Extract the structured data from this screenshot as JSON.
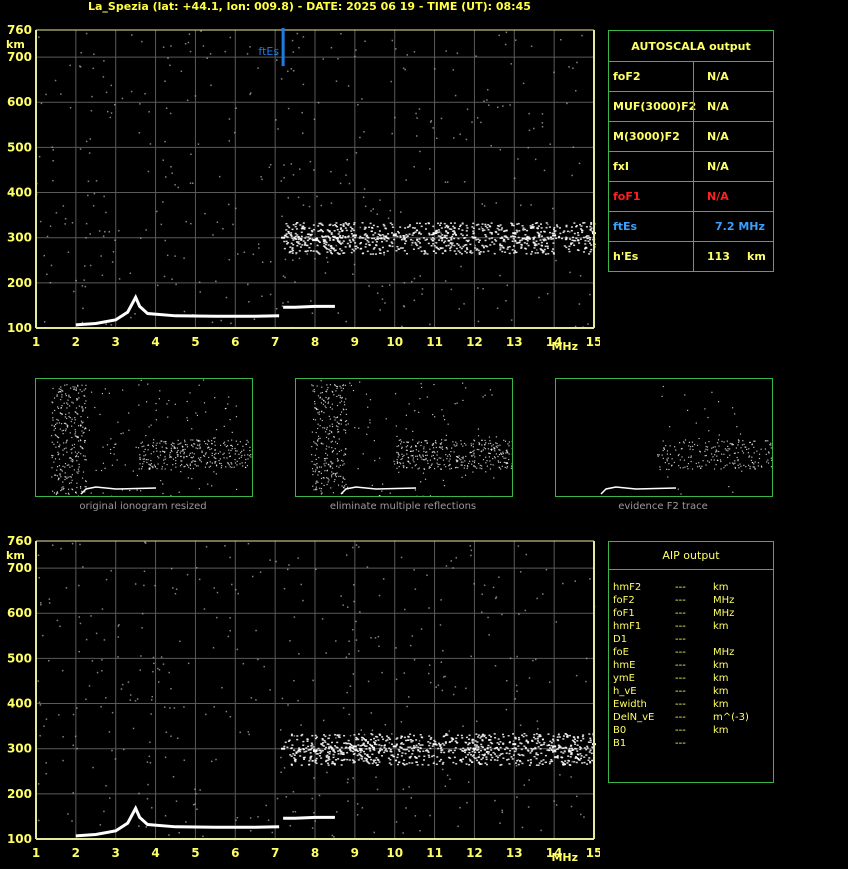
{
  "header": {
    "title": "La_Spezia (lat: +44.1, lon: 009.8) - DATE: 2025 06 19 - TIME (UT): 08:45"
  },
  "colors": {
    "axis": "#e8e89a",
    "grid": "#5a5a5a",
    "trace": "#ffffff",
    "fte_marker": "#1e7de0",
    "panel_border": "#39b54a",
    "label_yellow": "#ffff66",
    "label_red": "#ff2020",
    "label_blue": "#3aa0ff"
  },
  "chart_data": [
    {
      "type": "scatter",
      "title": "",
      "xlabel": "MHz",
      "ylabel": "km",
      "xlim": [
        1,
        15
      ],
      "ylim": [
        100,
        760
      ],
      "x_ticks": [
        "1",
        "2",
        "3",
        "4",
        "5",
        "6",
        "7",
        "8",
        "9",
        "10",
        "11",
        "12",
        "13",
        "14",
        "15"
      ],
      "y_ticks": [
        "100",
        "200",
        "300",
        "400",
        "500",
        "600",
        "700",
        "760"
      ],
      "grid": true,
      "traces": [
        {
          "name": "E-layer trace",
          "x": [
            2.0,
            2.5,
            3.0,
            3.3,
            3.5,
            3.6,
            3.8,
            4.5,
            5.5,
            6.5,
            7.1
          ],
          "y": [
            107,
            110,
            118,
            135,
            168,
            148,
            132,
            127,
            126,
            126,
            127
          ]
        },
        {
          "name": "Es trace",
          "x": [
            7.2,
            7.5,
            8.0,
            8.5
          ],
          "y": [
            146,
            146,
            148,
            148
          ]
        },
        {
          "name": "F-region echoes",
          "x": [
            7.2,
            8,
            9,
            10,
            11,
            12,
            13,
            14,
            15
          ],
          "y": [
            300,
            295,
            305,
            305,
            310,
            300,
            310,
            305,
            310
          ]
        }
      ],
      "marker": {
        "label": "ftEs",
        "x": 7.2,
        "y_range": [
          680,
          760
        ]
      }
    },
    {
      "type": "scatter",
      "title": "",
      "xlabel": "MHz",
      "ylabel": "km",
      "xlim": [
        1,
        15
      ],
      "ylim": [
        100,
        760
      ],
      "x_ticks": [
        "1",
        "2",
        "3",
        "4",
        "5",
        "6",
        "7",
        "8",
        "9",
        "10",
        "11",
        "12",
        "13",
        "14",
        "15"
      ],
      "y_ticks": [
        "100",
        "200",
        "300",
        "400",
        "500",
        "600",
        "700",
        "760"
      ],
      "grid": true,
      "traces": [
        {
          "name": "E-layer trace",
          "x": [
            2.0,
            2.5,
            3.0,
            3.3,
            3.5,
            3.6,
            3.8,
            4.5,
            5.5,
            6.5,
            7.1
          ],
          "y": [
            107,
            110,
            118,
            135,
            168,
            148,
            132,
            127,
            126,
            126,
            127
          ]
        },
        {
          "name": "Es trace",
          "x": [
            7.2,
            7.5,
            8.0,
            8.5
          ],
          "y": [
            146,
            146,
            148,
            148
          ]
        },
        {
          "name": "F-region echoes",
          "x": [
            7.2,
            8,
            9,
            10,
            11,
            12,
            13,
            14,
            15
          ],
          "y": [
            300,
            295,
            305,
            305,
            310,
            300,
            310,
            305,
            310
          ]
        }
      ]
    }
  ],
  "thumbnails": [
    {
      "caption": "original ionogram resized"
    },
    {
      "caption": "eliminate multiple reflections"
    },
    {
      "caption": "evidence F2 trace"
    }
  ],
  "autoscala": {
    "title": "AUTOSCALA output",
    "rows": [
      {
        "label": "foF2",
        "value": "N/A",
        "unit": "",
        "color": "#ffff66"
      },
      {
        "label": "MUF(3000)F2",
        "value": "N/A",
        "unit": "",
        "color": "#ffff66"
      },
      {
        "label": "M(3000)F2",
        "value": "N/A",
        "unit": "",
        "color": "#ffff66"
      },
      {
        "label": "fxI",
        "value": "N/A",
        "unit": "",
        "color": "#ffff66"
      },
      {
        "label": "foF1",
        "value": "N/A",
        "unit": "",
        "color": "#ff2020"
      },
      {
        "label": "ftEs",
        "value": "7.2 MHz",
        "unit": "",
        "color": "#3aa0ff"
      },
      {
        "label": "h'Es",
        "value": "113",
        "unit": "km",
        "color": "#ffff66"
      }
    ]
  },
  "aip": {
    "title": "AIP output",
    "rows": [
      {
        "param": "hmF2",
        "value": "---",
        "unit": "km"
      },
      {
        "param": "foF2",
        "value": "---",
        "unit": "MHz"
      },
      {
        "param": "foF1",
        "value": "---",
        "unit": "MHz"
      },
      {
        "param": "hmF1",
        "value": "---",
        "unit": "km"
      },
      {
        "param": "D1",
        "value": "---",
        "unit": ""
      },
      {
        "param": "foE",
        "value": "---",
        "unit": "MHz"
      },
      {
        "param": "hmE",
        "value": "---",
        "unit": "km"
      },
      {
        "param": "ymE",
        "value": "---",
        "unit": "km"
      },
      {
        "param": "h_vE",
        "value": "---",
        "unit": "km"
      },
      {
        "param": "Ewidth",
        "value": "---",
        "unit": "km"
      },
      {
        "param": "DelN_vE",
        "value": "---",
        "unit": "m^(-3)"
      },
      {
        "param": "B0",
        "value": "---",
        "unit": "km"
      },
      {
        "param": "B1",
        "value": "---",
        "unit": ""
      }
    ]
  }
}
